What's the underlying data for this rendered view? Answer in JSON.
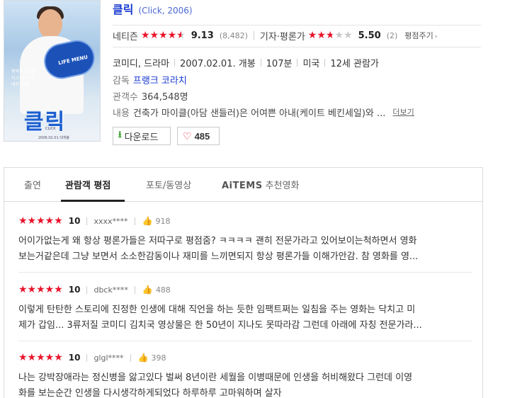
{
  "movie": {
    "title": "클릭",
    "subtitle": "(Click, 2006)",
    "poster": {
      "remote_text": "LIFE MENU",
      "logo_text": "클릭",
      "logo_sub": "CLICK",
      "side_text": "행복지고 의뢰지고 내 인생대로 할래!",
      "credit_text": "2006.02.01 대개봉"
    },
    "netizen": {
      "label": "네티즌",
      "score": "9.13",
      "votes": "(8,482)",
      "stars_filled": 4.5
    },
    "critic": {
      "label": "기자·평론가",
      "score": "5.50",
      "votes": "(2)",
      "stars_filled": 2.75
    },
    "rate_button": "평점주기",
    "meta": [
      "코미디, 드라마",
      "2007.02.01. 개봉",
      "107분",
      "미국",
      "12세 관람가"
    ],
    "director_label": "감독",
    "director": "프랭크 코라치",
    "audience_label": "관객수",
    "audience": "364,548명",
    "content_label": "내용",
    "content": "건축가 마이클(아담 샌들러)은 어여쁜 아내(케이트 베킨세일)와 ...",
    "more_link": "더보기",
    "download_label": "다운로드",
    "like_count": "485",
    "colors": {
      "accent": "#1a3bd1",
      "star": "#e8142b",
      "download": "#2a9b1e"
    }
  },
  "tabs": [
    {
      "label": "출연",
      "active": false
    },
    {
      "label": "관람객 평점",
      "active": true
    },
    {
      "label": "포토/동영상",
      "active": false
    },
    {
      "label": "AiTEMS",
      "suffix": "추천영화",
      "active": false
    }
  ],
  "reviews": [
    {
      "score": "10",
      "user": "xxxx****",
      "likes": "918",
      "lines": [
        "어이가없는게 왜 항상 평론가들은 저따구로 평점줌? ㅋㅋㅋㅋ 괜히 전문가라고 있어보이는척하면서 영화",
        "보는거같은데 그냥 보면서 소소한감동이나 재미를 느끼면되지 항상 평론가들 이해가안감. 참 영화를 영..."
      ]
    },
    {
      "score": "10",
      "user": "dbck****",
      "likes": "488",
      "lines": [
        "이렇게 탄탄한 스토리에 진정한 인생에 대해 직언을 하는 듯한 임팩트쩌는 일침을 주는 영화는 닥치고 미",
        "제가 갑임... 3류저질 코미디 김치국 영상물은 한 50년이 지나도 못따라감 그런데 아래에 자칭 전문가라..."
      ]
    },
    {
      "score": "10",
      "user": "glgl****",
      "likes": "398",
      "lines": [
        "나는 강박장애라는 정신병을 앓고있다 벌써 8년이란 세월을 이병때문에 인생을 허비해왔다 그런데 이영",
        "화를 보는순간 인생을 다시생각하게되었다 하루하루 고마워하며 살자"
      ]
    }
  ]
}
